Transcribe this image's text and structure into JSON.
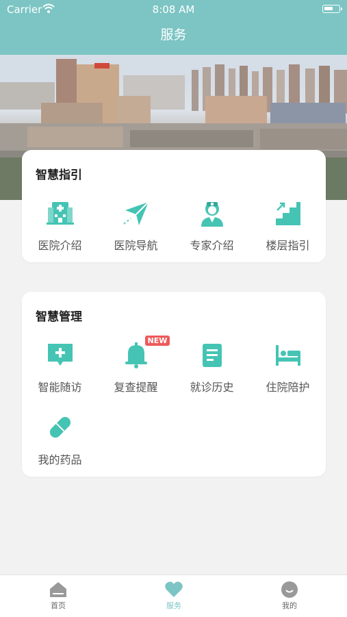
{
  "status_bar": {
    "carrier": "Carrier",
    "time": "8:08 AM"
  },
  "nav": {
    "title": "服务"
  },
  "colors": {
    "accent": "#7cc5c4",
    "icon": "#45c4b4",
    "badge": "#ee5a5a"
  },
  "smart_guide": {
    "title": "智慧指引",
    "items": [
      {
        "label": "医院介绍",
        "icon": "hospital-icon"
      },
      {
        "label": "医院导航",
        "icon": "navigation-arrow-icon"
      },
      {
        "label": "专家介绍",
        "icon": "doctor-icon"
      },
      {
        "label": "楼层指引",
        "icon": "stairs-icon"
      }
    ]
  },
  "smart_management": {
    "title": "智慧管理",
    "items": [
      {
        "label": "智能随访",
        "icon": "chat-plus-icon"
      },
      {
        "label": "复查提醒",
        "icon": "bell-icon",
        "badge": "NEW"
      },
      {
        "label": "就诊历史",
        "icon": "document-icon"
      },
      {
        "label": "住院陪护",
        "icon": "bed-icon"
      },
      {
        "label": "我的药品",
        "icon": "pill-icon"
      }
    ]
  },
  "tabbar": {
    "items": [
      {
        "label": "首页",
        "icon": "home-icon",
        "active": false
      },
      {
        "label": "服务",
        "icon": "heart-icon",
        "active": true
      },
      {
        "label": "我的",
        "icon": "smiley-icon",
        "active": false
      }
    ]
  }
}
